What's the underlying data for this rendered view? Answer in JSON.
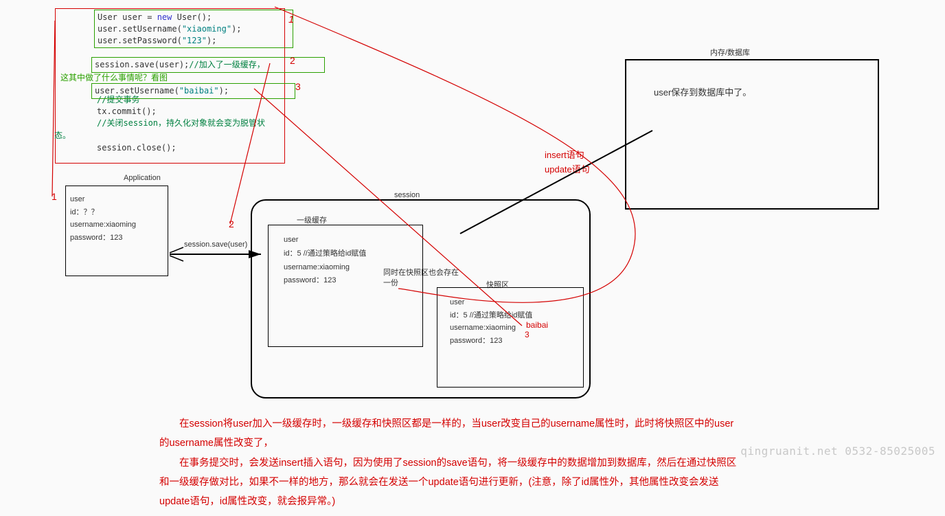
{
  "code": {
    "line1a": "User user = ",
    "line1b": "new",
    "line1c": " User();",
    "line2a": "user.setUsername(",
    "line2b": "\"xiaoming\"",
    "line2c": ");",
    "line3a": "user.setPassword(",
    "line3b": "\"123\"",
    "line3c": ");",
    "line5a": "session.save(user);",
    "line5b": "//加入了一级缓存，",
    "line7a": "user.setUsername(",
    "line7b": "\"baibai\"",
    "line7c": ");",
    "line8": "//提交事务",
    "line9": "tx.commit();",
    "line10": "//关闭session，持久化对象就会变为脱管状",
    "line10b": "态。",
    "line12": "session.close();"
  },
  "greenNote": "这其中做了什么事情呢？看图",
  "label1": "1",
  "label2": "2",
  "label3": "3",
  "label1b": "1",
  "label2b": "2",
  "label3b": "3",
  "labelBaibai": "baibai",
  "app": {
    "title": "Application",
    "l1": "user",
    "l2": "id：？？",
    "l3": "username:xiaoming",
    "l4": "password：123"
  },
  "session": {
    "title": "session"
  },
  "cache": {
    "title": "一级缓存",
    "l1": "user",
    "l2": "id：5 //通过策略给id赋值",
    "l3": "username:xiaoming",
    "l4": "password：123"
  },
  "snapshot": {
    "title": "快照区",
    "l1": "user",
    "l2": "id：5 //通过策略给id赋值",
    "l3": "username:xiaoming",
    "l4": "password：123"
  },
  "midNote": "同时在快照区也会存在一份",
  "db": {
    "title": "内存/数据库",
    "l1": "user保存到数据库中了。"
  },
  "sql": {
    "l1": "insert语句",
    "l2": "update语句"
  },
  "saveText": "session.save(user)",
  "bottom": {
    "p1a": "在session将user加入一级缓存时，一级缓存和快照区都是一样的，当user改变自己的username属性时，此时将快照区中的user",
    "p1b": "的username属性改变了，",
    "p2a": "在事务提交时，会发送insert插入语句，因为使用了session的save语句，将一级缓存中的数据增加到数据库，然后在通过快照区",
    "p2b": "和一级缓存做对比，如果不一样的地方，那么就会在发送一个update语句进行更新，(注意，除了id属性外，其他属性改变会发送",
    "p2c": "update语句，id属性改变，就会报异常。)"
  },
  "watermark": "qingruanit.net 0532-85025005"
}
